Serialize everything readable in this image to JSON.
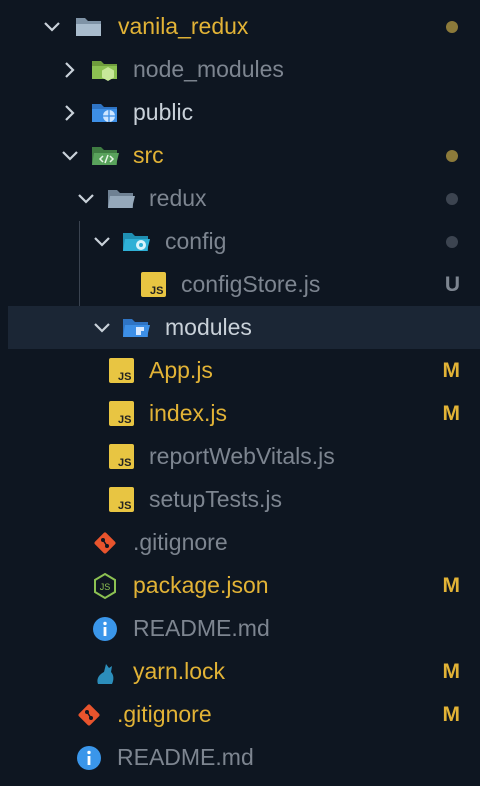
{
  "explorer": {
    "items": [
      {
        "label": "vanila_redux",
        "status": "",
        "dot": "#8c7a3a"
      },
      {
        "label": "node_modules"
      },
      {
        "label": "public"
      },
      {
        "label": "src",
        "dot": "#8c7a3a"
      },
      {
        "label": "redux",
        "dot": "#3c4450"
      },
      {
        "label": "config",
        "dot": "#3c4450"
      },
      {
        "label": "configStore.js",
        "status": "U"
      },
      {
        "label": "modules"
      },
      {
        "label": "App.js",
        "status": "M"
      },
      {
        "label": "index.js",
        "status": "M"
      },
      {
        "label": "reportWebVitals.js"
      },
      {
        "label": "setupTests.js"
      },
      {
        "label": ".gitignore"
      },
      {
        "label": "package.json",
        "status": "M"
      },
      {
        "label": "README.md"
      },
      {
        "label": "yarn.lock",
        "status": "M"
      },
      {
        "label": ".gitignore",
        "status": "M"
      },
      {
        "label": "README.md"
      }
    ]
  },
  "icon_text": {
    "js": "JS"
  },
  "colors": {
    "modified": "#e2b336",
    "untracked": "#7d8590",
    "folder": "#8fa3b5",
    "node_folder": "#8cc152",
    "public_folder": "#3d8fe6",
    "src_folder": "#59a35c",
    "config_folder": "#2fb0d6",
    "git": "#e8542d",
    "info": "#3a96ea"
  }
}
